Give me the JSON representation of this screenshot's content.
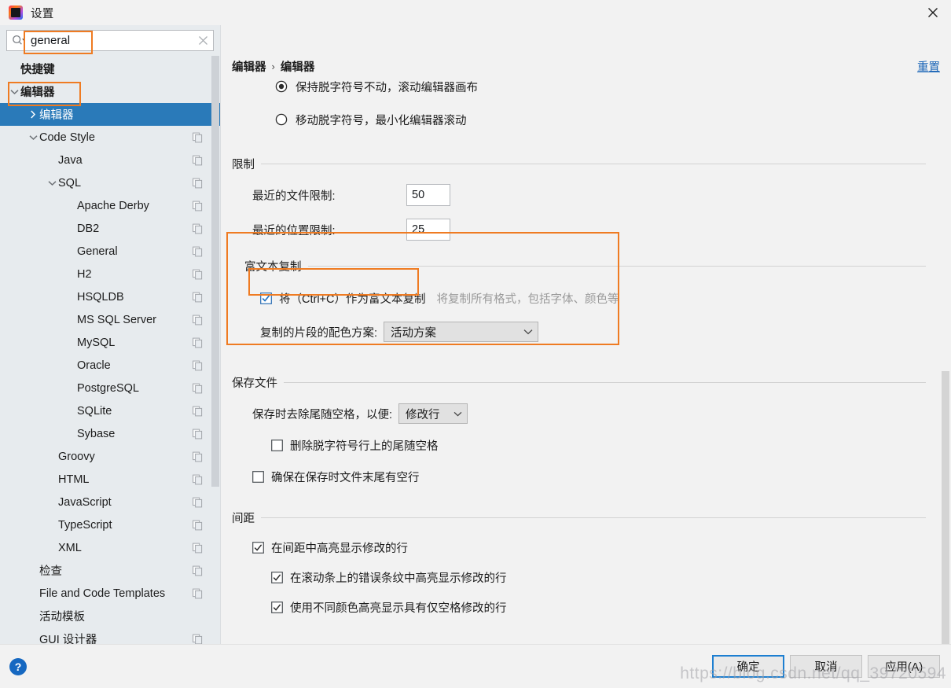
{
  "window": {
    "title": "设置",
    "app_icon": "intellij-idea-icon",
    "close_icon": "close-icon"
  },
  "search": {
    "value": "general",
    "placeholder": "",
    "search_icon": "search-icon",
    "clear_icon": "clear-icon"
  },
  "sidebar": {
    "items": [
      {
        "label": "快捷键",
        "indent": 0,
        "bold": true,
        "twisty": "none",
        "badge": false,
        "selected": false
      },
      {
        "label": "编辑器",
        "indent": 0,
        "bold": true,
        "twisty": "expanded",
        "badge": false,
        "selected": false
      },
      {
        "label": "编辑器",
        "indent": 1,
        "bold": false,
        "twisty": "collapsed",
        "badge": false,
        "selected": true
      },
      {
        "label": "Code Style",
        "indent": 1,
        "bold": false,
        "twisty": "expanded",
        "badge": true,
        "selected": false
      },
      {
        "label": "Java",
        "indent": 2,
        "bold": false,
        "twisty": "none",
        "badge": true,
        "selected": false
      },
      {
        "label": "SQL",
        "indent": 2,
        "bold": false,
        "twisty": "expanded",
        "badge": true,
        "selected": false
      },
      {
        "label": "Apache Derby",
        "indent": 3,
        "bold": false,
        "twisty": "none",
        "badge": true,
        "selected": false
      },
      {
        "label": "DB2",
        "indent": 3,
        "bold": false,
        "twisty": "none",
        "badge": true,
        "selected": false
      },
      {
        "label": "General",
        "indent": 3,
        "bold": false,
        "twisty": "none",
        "badge": true,
        "selected": false
      },
      {
        "label": "H2",
        "indent": 3,
        "bold": false,
        "twisty": "none",
        "badge": true,
        "selected": false
      },
      {
        "label": "HSQLDB",
        "indent": 3,
        "bold": false,
        "twisty": "none",
        "badge": true,
        "selected": false
      },
      {
        "label": "MS SQL Server",
        "indent": 3,
        "bold": false,
        "twisty": "none",
        "badge": true,
        "selected": false
      },
      {
        "label": "MySQL",
        "indent": 3,
        "bold": false,
        "twisty": "none",
        "badge": true,
        "selected": false
      },
      {
        "label": "Oracle",
        "indent": 3,
        "bold": false,
        "twisty": "none",
        "badge": true,
        "selected": false
      },
      {
        "label": "PostgreSQL",
        "indent": 3,
        "bold": false,
        "twisty": "none",
        "badge": true,
        "selected": false
      },
      {
        "label": "SQLite",
        "indent": 3,
        "bold": false,
        "twisty": "none",
        "badge": true,
        "selected": false
      },
      {
        "label": "Sybase",
        "indent": 3,
        "bold": false,
        "twisty": "none",
        "badge": true,
        "selected": false
      },
      {
        "label": "Groovy",
        "indent": 2,
        "bold": false,
        "twisty": "none",
        "badge": true,
        "selected": false
      },
      {
        "label": "HTML",
        "indent": 2,
        "bold": false,
        "twisty": "none",
        "badge": true,
        "selected": false
      },
      {
        "label": "JavaScript",
        "indent": 2,
        "bold": false,
        "twisty": "none",
        "badge": true,
        "selected": false
      },
      {
        "label": "TypeScript",
        "indent": 2,
        "bold": false,
        "twisty": "none",
        "badge": true,
        "selected": false
      },
      {
        "label": "XML",
        "indent": 2,
        "bold": false,
        "twisty": "none",
        "badge": true,
        "selected": false
      },
      {
        "label": "检查",
        "indent": 1,
        "bold": false,
        "twisty": "none",
        "badge": true,
        "selected": false
      },
      {
        "label": "File and Code Templates",
        "indent": 1,
        "bold": false,
        "twisty": "none",
        "badge": true,
        "selected": false
      },
      {
        "label": "活动模板",
        "indent": 1,
        "bold": false,
        "twisty": "none",
        "badge": false,
        "selected": false
      },
      {
        "label": "GUI 设计器",
        "indent": 1,
        "bold": false,
        "twisty": "none",
        "badge": true,
        "selected": false
      }
    ]
  },
  "main": {
    "breadcrumb": {
      "root": "编辑器",
      "separator": "›",
      "leaf": "编辑器"
    },
    "reset_label": "重置",
    "caret_options": [
      {
        "label": "保持脱字符号不动，滚动编辑器画布",
        "selected": true
      },
      {
        "label": "移动脱字符号，最小化编辑器滚动",
        "selected": false
      }
    ],
    "limits": {
      "title": "限制",
      "recent_files_label": "最近的文件限制:",
      "recent_files_value": "50",
      "recent_locations_label": "最近的位置限制:",
      "recent_locations_value": "25"
    },
    "rich_copy": {
      "title": "富文本复制",
      "checkbox_label": "将（Ctrl+C）作为富文本复制",
      "checkbox_checked": true,
      "hint": "将复制所有格式，包括字体、颜色等",
      "scheme_label": "复制的片段的配色方案:",
      "scheme_value": "活动方案"
    },
    "save_files": {
      "title": "保存文件",
      "strip_label": "保存时去除尾随空格，以便:",
      "strip_value": "修改行",
      "caret_line_label": "删除脱字符号行上的尾随空格",
      "caret_line_checked": false,
      "blank_line_label": "确保在保存时文件末尾有空行",
      "blank_line_checked": false
    },
    "gutter": {
      "title": "间距",
      "items": [
        {
          "label": "在间距中高亮显示修改的行",
          "checked": true,
          "indent": 0
        },
        {
          "label": "在滚动条上的错误条纹中高亮显示修改的行",
          "checked": true,
          "indent": 1
        },
        {
          "label": "使用不同颜色高亮显示具有仅空格修改的行",
          "checked": true,
          "indent": 1
        }
      ]
    }
  },
  "footer": {
    "help_icon": "help-icon",
    "ok_label": "确定",
    "cancel_label": "取消",
    "apply_label": "应用(A)"
  },
  "watermark": {
    "text": "https://blog.csdn.net/qq_39720594"
  },
  "colors": {
    "selection_blue": "#2a7ab9",
    "highlight_orange": "#ef7b22",
    "link_blue": "#1662b6",
    "sidebar_bg": "#e7ebee",
    "panel_bg": "#f2f2f2",
    "accent_default_button": "#1d7fd1"
  }
}
